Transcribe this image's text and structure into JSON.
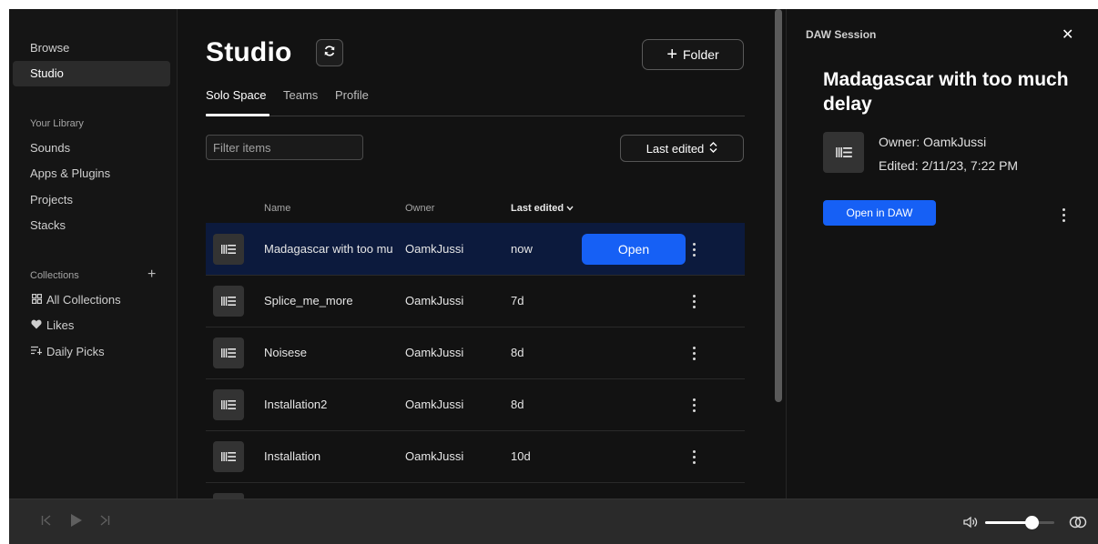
{
  "sidebar": {
    "nav": [
      "Browse",
      "Studio"
    ],
    "active": "Studio",
    "library_label": "Your Library",
    "library_items": [
      "Sounds",
      "Apps & Plugins",
      "Projects",
      "Stacks"
    ],
    "collections_label": "Collections",
    "collections_add": "+",
    "collection_items": [
      {
        "label": "All Collections",
        "icon": "grid-icon"
      },
      {
        "label": "Likes",
        "icon": "heart-icon"
      },
      {
        "label": "Daily Picks",
        "icon": "daily-picks-icon"
      }
    ]
  },
  "main": {
    "title": "Studio",
    "folder_button": "Folder",
    "tabs": [
      "Solo Space",
      "Teams",
      "Profile"
    ],
    "active_tab": "Solo Space",
    "filter_placeholder": "Filter items",
    "sort_label": "Last edited",
    "columns": {
      "name": "Name",
      "owner": "Owner",
      "edited": "Last edited"
    },
    "open_label": "Open",
    "rows": [
      {
        "name": "Madagascar with too much delay",
        "owner": "OamkJussi",
        "edited": "now",
        "selected": true
      },
      {
        "name": "Splice_me_more",
        "owner": "OamkJussi",
        "edited": "7d"
      },
      {
        "name": "Noisese",
        "owner": "OamkJussi",
        "edited": "8d"
      },
      {
        "name": "Installation2",
        "owner": "OamkJussi",
        "edited": "8d"
      },
      {
        "name": "Installation",
        "owner": "OamkJussi",
        "edited": "10d"
      }
    ]
  },
  "panel": {
    "label": "DAW Session",
    "title": "Madagascar with too much delay",
    "owner": "Owner: OamkJussi",
    "edited": "Edited: 2/11/23, 7:22 PM",
    "open_daw": "Open in DAW"
  },
  "player": {
    "volume": 0.68
  },
  "colors": {
    "accent": "#1660f5",
    "selected_row": "#0c1a3d",
    "background": "#121212"
  }
}
